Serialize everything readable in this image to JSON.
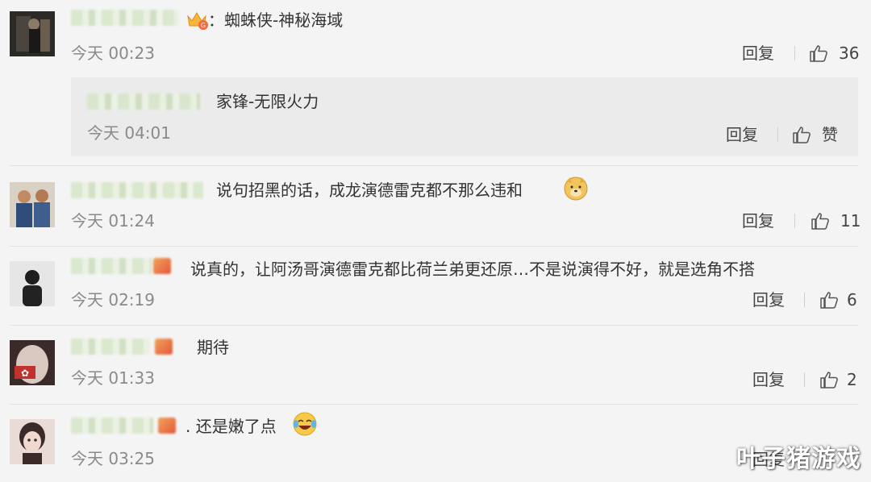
{
  "comments": [
    {
      "text": "：蜘蛛侠-神秘海域",
      "time": "今天 00:23",
      "reply_label": "回复",
      "like_count": "36",
      "sub_reply": {
        "text": "家锋-无限火力",
        "time": "今天 04:01",
        "reply_label": "回复",
        "like_label": "赞"
      }
    },
    {
      "text": "说句招黑的话，成龙演德雷克都不那么违和",
      "time": "今天 01:24",
      "reply_label": "回复",
      "like_count": "11"
    },
    {
      "text": "说真的，让阿汤哥演德雷克都比荷兰弟更还原…不是说演得不好，就是选角不搭",
      "time": "今天 02:19",
      "reply_label": "回复",
      "like_count": "6"
    },
    {
      "text": "期待",
      "time": "今天 01:33",
      "reply_label": "回复",
      "like_count": "2"
    },
    {
      "text": ". 还是嫩了点",
      "time": "今天 03:25",
      "reply_label": "回复"
    }
  ],
  "watermark": "叶子猪游戏",
  "icons": [
    "thumbs-up-icon",
    "crown-icon",
    "doge-emoji",
    "laugh-cry-emoji"
  ],
  "colors": {
    "background": "#f4f4f4",
    "reply_box": "#ebebeb",
    "muted_text": "#8a8a8a"
  }
}
